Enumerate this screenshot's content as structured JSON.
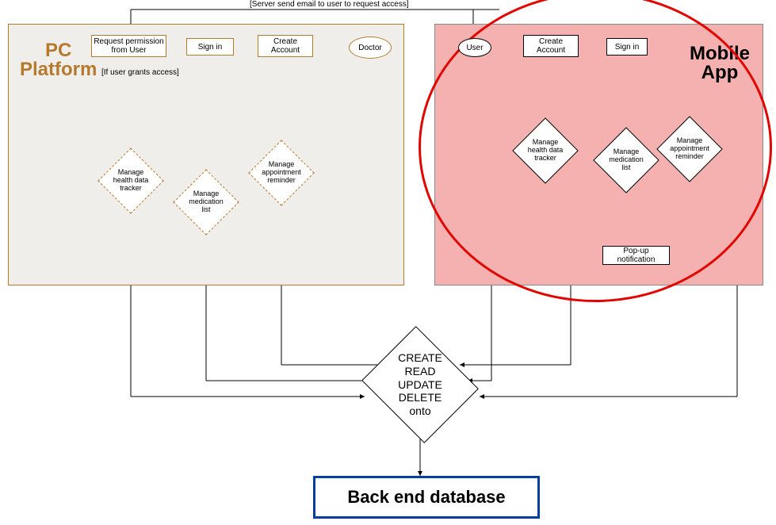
{
  "titles": {
    "pc": "PC\nPlatform",
    "mobile": "Mobile\nApp"
  },
  "guards": {
    "server_email": "[Server send email to user to request access]",
    "user_grants": "[If user grants access]"
  },
  "pc": {
    "doctor": "Doctor",
    "create_account": "Create\nAccount",
    "sign_in": "Sign in",
    "request_permission": "Request permission\nfrom User",
    "health_tracker": "Manage health data tracker",
    "medication_list": "Manage medication list",
    "appointment_reminder": "Manage appointment reminder"
  },
  "mobile": {
    "user": "User",
    "create_account": "Create\nAccount",
    "sign_in": "Sign in",
    "health_tracker": "Manage health data tracker",
    "medication_list": "Manage medication list",
    "appointment_reminder": "Manage appointment reminder",
    "popup": "Pop-up notification"
  },
  "center": {
    "crud": "CREATE\nREAD\nUPDATE\nDELETE\nonto"
  },
  "db": {
    "label": "Back end database"
  }
}
